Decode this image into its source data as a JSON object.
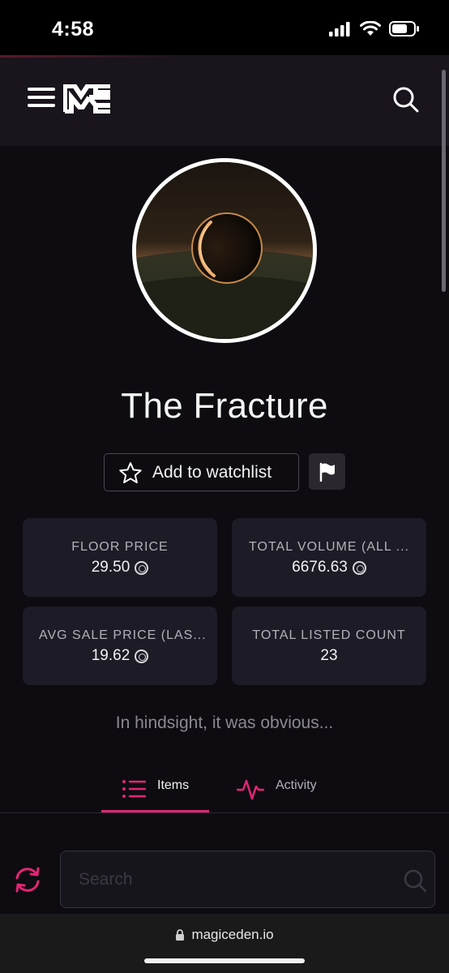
{
  "status_bar": {
    "time": "4:58"
  },
  "header": {
    "menu_icon": "hamburger-menu-icon",
    "logo_icon": "magic-eden-logo",
    "search_icon": "search-icon"
  },
  "collection": {
    "name": "The Fracture",
    "tagline": "In hindsight, it was obvious..."
  },
  "actions": {
    "watchlist_label": "Add to watchlist",
    "flag_icon": "flag-icon"
  },
  "stats": [
    {
      "label": "FLOOR PRICE",
      "value": "29.50",
      "currency_icon": "sol-icon"
    },
    {
      "label": "TOTAL VOLUME (ALL ...",
      "value": "6676.63",
      "currency_icon": "sol-icon"
    },
    {
      "label": "AVG SALE PRICE (LAS...",
      "value": "19.62",
      "currency_icon": "sol-icon"
    },
    {
      "label": "TOTAL LISTED COUNT",
      "value": "23"
    }
  ],
  "tabs": [
    {
      "label": "Items",
      "icon": "list-icon",
      "active": true
    },
    {
      "label": "Activity",
      "icon": "activity-pulse-icon",
      "active": false
    }
  ],
  "search": {
    "placeholder": "Search"
  },
  "browser": {
    "url": "magiceden.io"
  },
  "colors": {
    "accent": "#e42575",
    "background": "#0e0c11",
    "card": "#1d1b26"
  }
}
